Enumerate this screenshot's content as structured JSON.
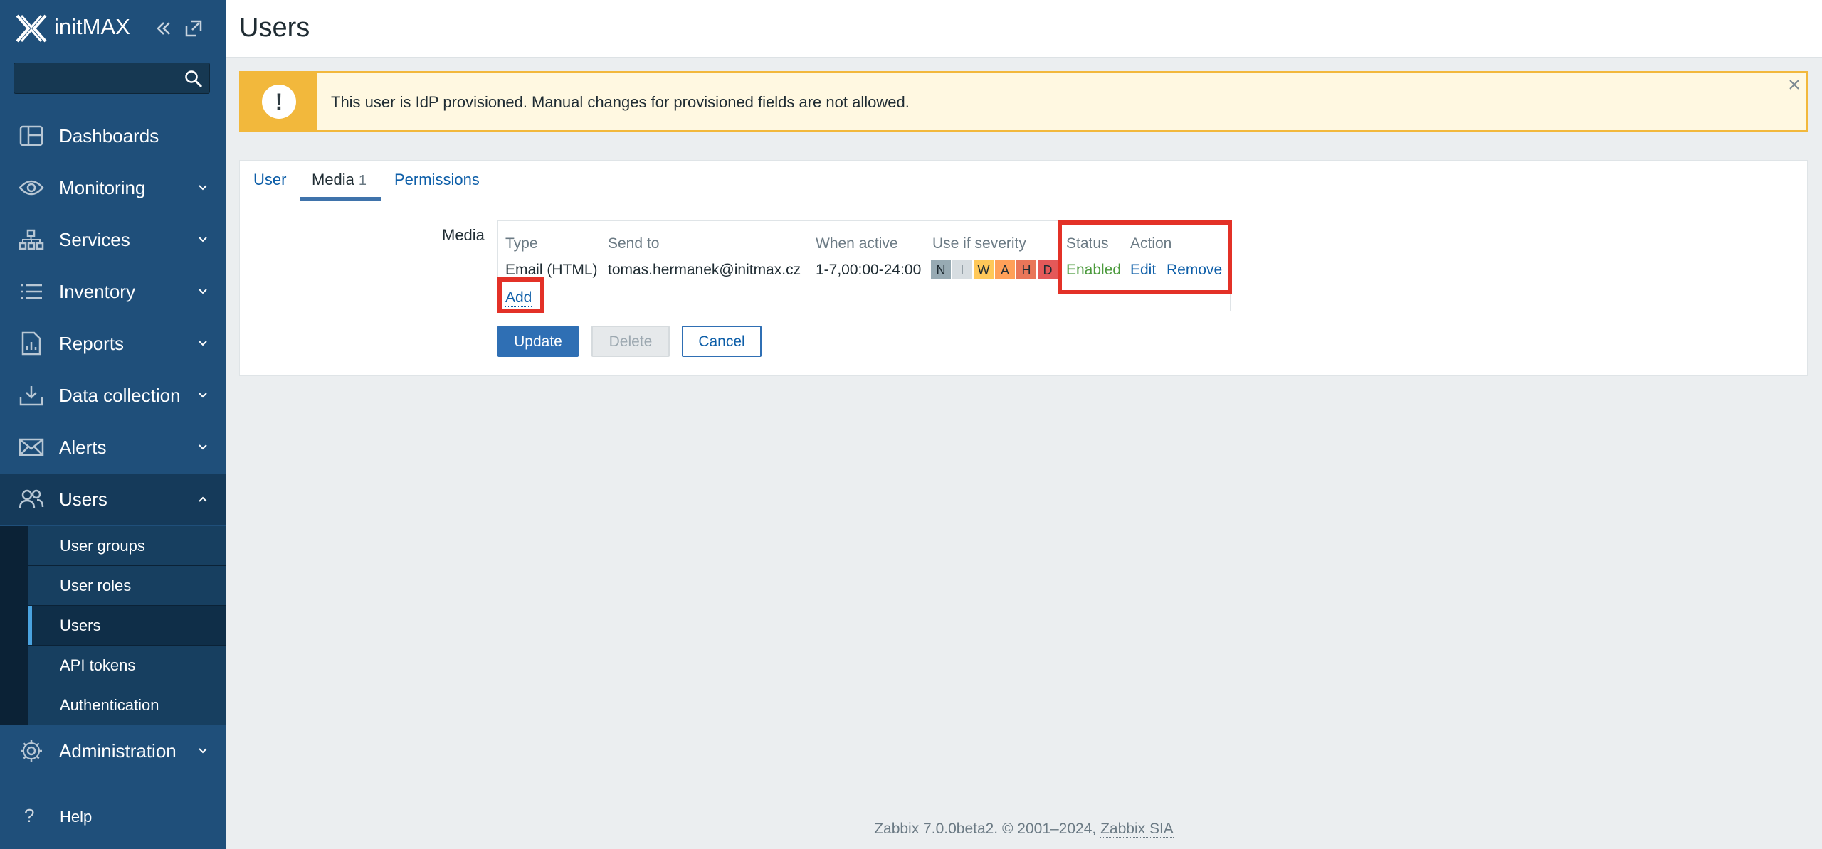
{
  "sidebar": {
    "brand": "initMAX",
    "search": {
      "value": "",
      "placeholder": ""
    },
    "items": [
      {
        "label": "Dashboards",
        "icon": "dashboard-icon",
        "chevron": false
      },
      {
        "label": "Monitoring",
        "icon": "eye-icon",
        "chevron": true
      },
      {
        "label": "Services",
        "icon": "services-tree-icon",
        "chevron": true
      },
      {
        "label": "Inventory",
        "icon": "list-icon",
        "chevron": true
      },
      {
        "label": "Reports",
        "icon": "report-icon",
        "chevron": true
      },
      {
        "label": "Data collection",
        "icon": "download-icon",
        "chevron": true
      },
      {
        "label": "Alerts",
        "icon": "envelope-icon",
        "chevron": true
      },
      {
        "label": "Users",
        "icon": "users-icon",
        "chevron": true,
        "expanded": true
      },
      {
        "label": "Administration",
        "icon": "gear-icon",
        "chevron": true
      }
    ],
    "users_submenu": [
      "User groups",
      "User roles",
      "Users",
      "API tokens",
      "Authentication"
    ],
    "help": "Help"
  },
  "header": {
    "title": "Users"
  },
  "warning": {
    "message": "This user is IdP provisioned. Manual changes for provisioned fields are not allowed."
  },
  "tabs": [
    {
      "label": "User",
      "count": ""
    },
    {
      "label": "Media",
      "count": "1"
    },
    {
      "label": "Permissions",
      "count": ""
    }
  ],
  "media": {
    "field_label": "Media",
    "columns": [
      "Type",
      "Send to",
      "When active",
      "Use if severity",
      "Status",
      "Action"
    ],
    "rows": [
      {
        "type": "Email (HTML)",
        "send_to": "tomas.hermanek@initmax.cz",
        "when_active": "1-7,00:00-24:00",
        "severity": [
          "N",
          "I",
          "W",
          "A",
          "H",
          "D"
        ],
        "status": "Enabled",
        "edit": "Edit",
        "remove": "Remove"
      }
    ],
    "add_label": "Add"
  },
  "buttons": {
    "update": "Update",
    "delete": "Delete",
    "cancel": "Cancel"
  },
  "footer": {
    "text": "Zabbix 7.0.0beta2. © 2001–2024, ",
    "link": "Zabbix SIA"
  },
  "colors": {
    "sidebar": "#1f4f7a",
    "accent": "#0d5ea8",
    "warning": "#f2b83c",
    "highlight": "#e33127",
    "enabled": "#4b9a3c"
  }
}
